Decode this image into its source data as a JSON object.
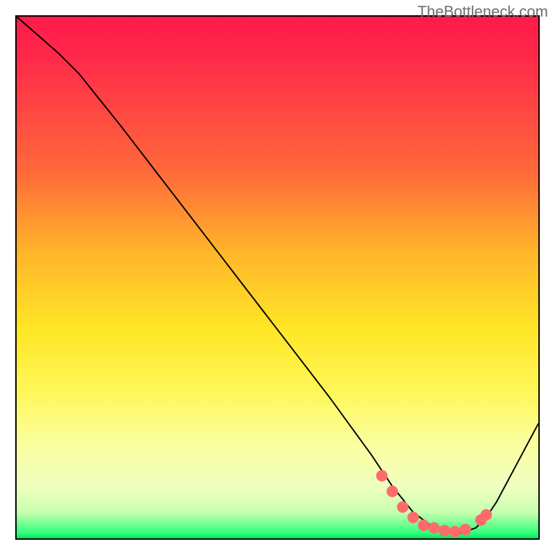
{
  "watermark": "TheBottleneck.com",
  "chart_data": {
    "type": "line",
    "title": "",
    "xlabel": "",
    "ylabel": "",
    "xlim": [
      0,
      100
    ],
    "ylim": [
      0,
      100
    ],
    "series": [
      {
        "name": "bottleneck-curve",
        "color": "#000000",
        "x": [
          0,
          8,
          12,
          20,
          30,
          40,
          50,
          60,
          68,
          72,
          76,
          80,
          83,
          85,
          88,
          90,
          92,
          100
        ],
        "y": [
          100,
          93,
          89,
          79,
          66,
          53,
          40,
          27,
          16,
          10,
          5,
          2,
          1,
          1,
          2,
          4,
          7,
          22
        ]
      }
    ],
    "highlight_points": {
      "name": "optimal-range-dots",
      "color": "#ff6b6b",
      "x": [
        70,
        72,
        74,
        76,
        78,
        80,
        82,
        84,
        86,
        89,
        90
      ],
      "y": [
        12,
        9,
        6,
        4,
        2.5,
        2,
        1.5,
        1.3,
        1.7,
        3.5,
        4.5
      ]
    },
    "gradient_stops": [
      {
        "pos": 0,
        "color": "#ff1a4a"
      },
      {
        "pos": 30,
        "color": "#ff6a3a"
      },
      {
        "pos": 60,
        "color": "#ffe626"
      },
      {
        "pos": 90,
        "color": "#f0ffc0"
      },
      {
        "pos": 100,
        "color": "#07e060"
      }
    ]
  }
}
